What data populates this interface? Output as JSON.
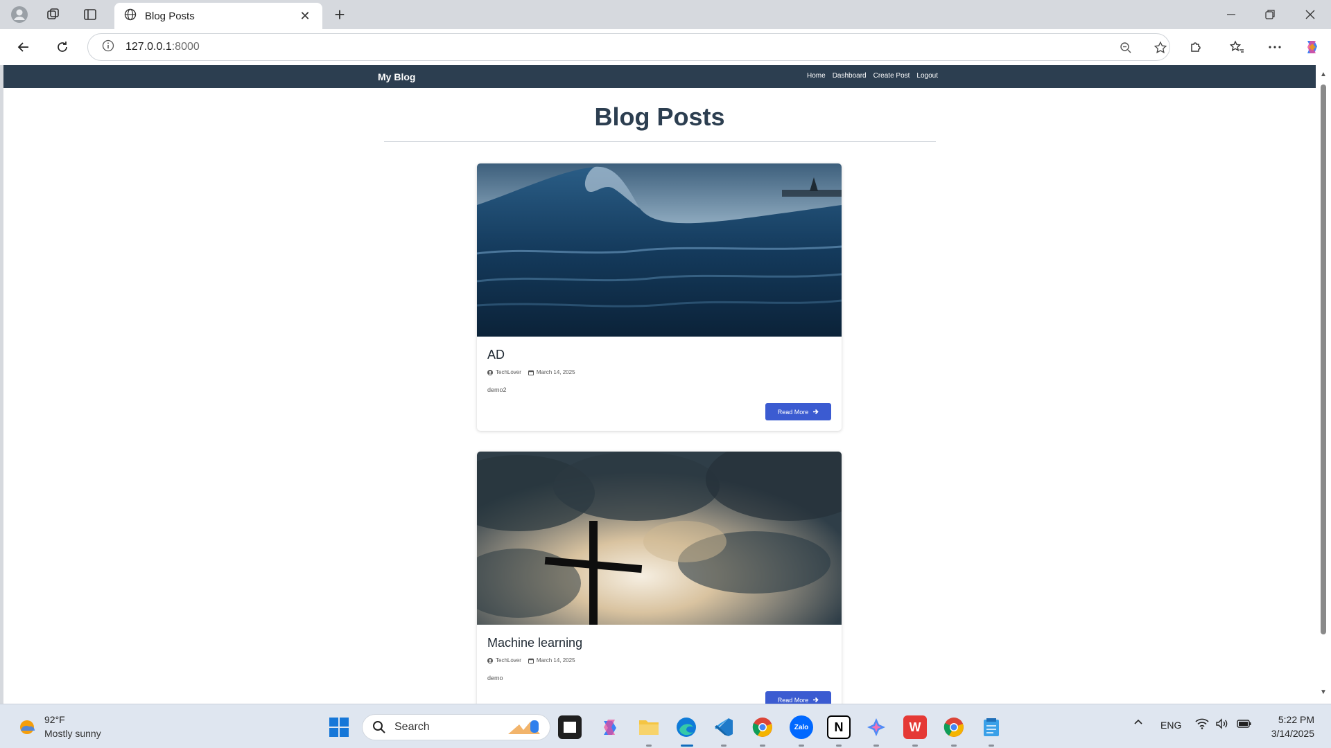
{
  "browser": {
    "tab_title": "Blog Posts",
    "url_host": "127.0.0.1",
    "url_port": ":8000"
  },
  "site": {
    "brand": "My Blog",
    "nav": [
      "Home",
      "Dashboard",
      "Create Post",
      "Logout"
    ],
    "page_title": "Blog Posts"
  },
  "posts": [
    {
      "title": "AD",
      "author": "TechLover",
      "date": "March 14, 2025",
      "excerpt": "demo2",
      "button": "Read More",
      "image": "ocean-wave"
    },
    {
      "title": "Machine learning",
      "author": "TechLover",
      "date": "March 14, 2025",
      "excerpt": "demo",
      "button": "Read More",
      "image": "cross-clouds-sky"
    }
  ],
  "taskbar": {
    "weather_temp": "92°F",
    "weather_desc": "Mostly sunny",
    "search_placeholder": "Search",
    "lang": "ENG",
    "time": "5:22 PM",
    "date": "3/14/2025"
  },
  "colors": {
    "nav_bg": "#2c3e50",
    "title": "#2c3e50",
    "button": "#3b5bd1"
  }
}
